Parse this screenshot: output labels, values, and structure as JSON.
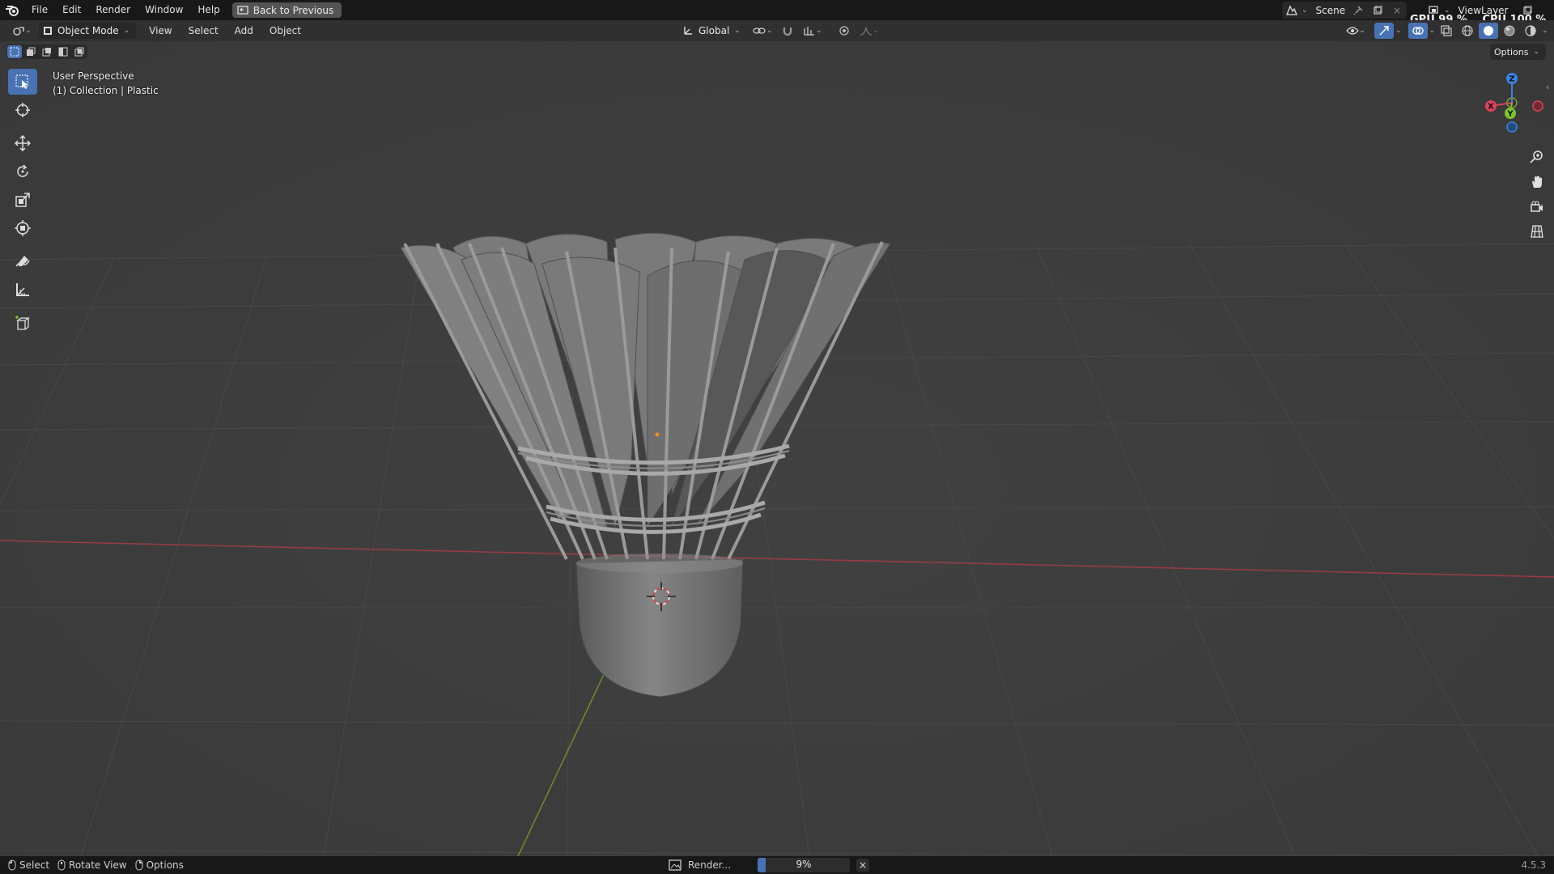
{
  "topbar": {
    "menus": [
      "File",
      "Edit",
      "Render",
      "Window",
      "Help"
    ],
    "back_label": "Back to Previous",
    "scene_label": "Scene",
    "viewlayer_label": "ViewLayer",
    "gpu_label": "GPU",
    "gpu_value": "99 %",
    "cpu_label": "CPU",
    "cpu_value": "100 %"
  },
  "header": {
    "mode_label": "Object Mode",
    "menus": [
      "View",
      "Select",
      "Add",
      "Object"
    ],
    "transform_orientation": "Global",
    "options_label": "Options"
  },
  "viewport": {
    "perspective_label": "User Perspective",
    "collection_label": "(1) Collection | Plastic",
    "gizmo_axes": {
      "x": "X",
      "y": "Y",
      "z": "Z"
    }
  },
  "statusbar": {
    "select_label": "Select",
    "rotate_label": "Rotate View",
    "options_label": "Options",
    "render_label": "Render...",
    "progress_text": "9%",
    "progress_value": 0.09,
    "version": "4.5.3"
  },
  "colors": {
    "accent": "#4772b3",
    "x_axis": "#e0425a",
    "y_axis": "#7cc42c",
    "z_axis": "#3c83e6",
    "grid_bg": "#3d3d3d"
  }
}
